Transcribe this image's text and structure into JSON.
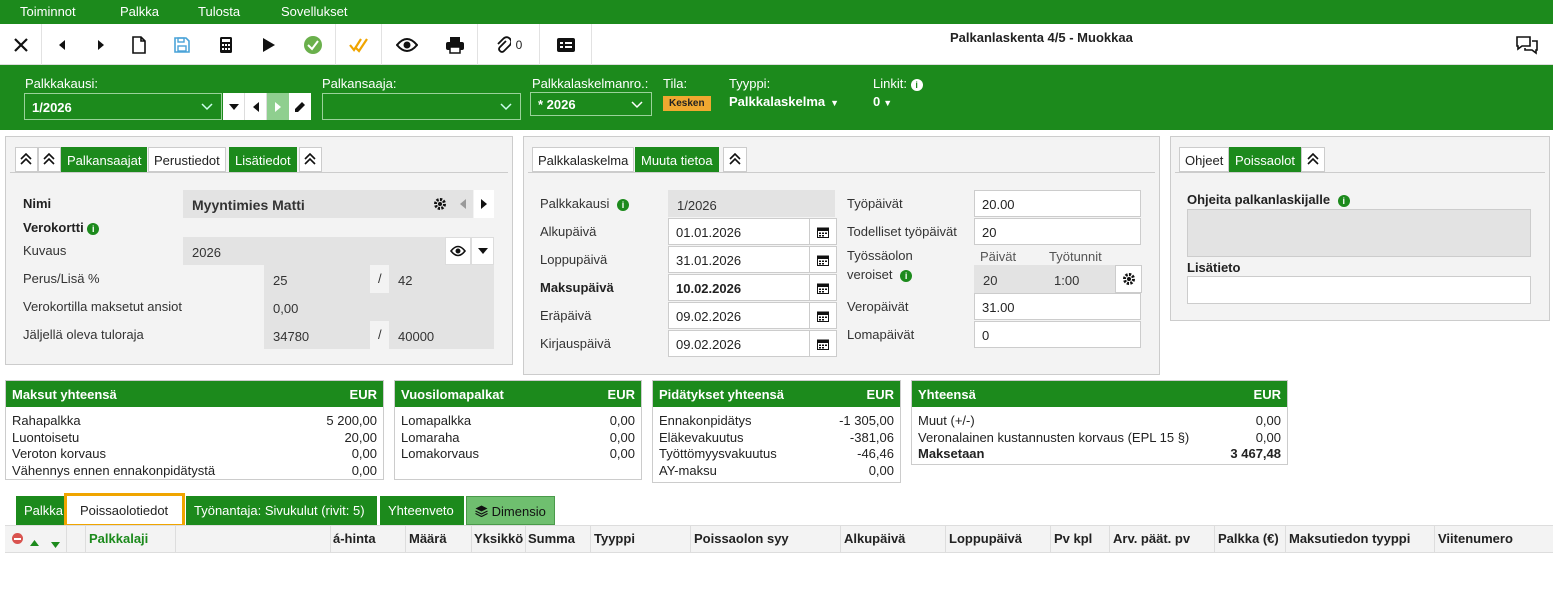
{
  "menu": [
    "Toiminnot",
    "Palkka",
    "Tulosta",
    "Sovellukset"
  ],
  "toolbar": {
    "attachments_count": "0"
  },
  "window_title": "Palkanlaskenta 4/5 - Muokkaa",
  "header": {
    "palkkakausi_label": "Palkkakausi:",
    "palkkakausi_value": "1/2026",
    "palkansaaja_label": "Palkansaaja:",
    "palkansaaja_value": "",
    "laskelmanro_label": "Palkkalaskelmanro.:",
    "laskelmanro_value": "* 2026",
    "tila_label": "Tila:",
    "tila_value": "Kesken",
    "tyyppi_label": "Tyyppi:",
    "tyyppi_value": "Palkkalaskelma",
    "linkit_label": "Linkit:",
    "linkit_value": "0"
  },
  "left_panel": {
    "tabs": [
      "Palkansaajat",
      "Perustiedot",
      "Lisätiedot"
    ],
    "nimi_label": "Nimi",
    "nimi_value": "Myyntimies Matti",
    "verokortti_label": "Verokortti",
    "kuvaus_label": "Kuvaus",
    "kuvaus_value": "2026",
    "perus_label": "Perus/Lisä %",
    "perus_value": "25",
    "lisa_value": "42",
    "maksetut_label": "Verokortilla maksetut ansiot",
    "maksetut_value": "0,00",
    "tuloraja_label": "Jäljellä oleva tuloraja",
    "tuloraja_value": "34780",
    "tuloraja_max": "40000",
    "slash": "/"
  },
  "mid_panel": {
    "tabs": [
      "Palkkalaskelma",
      "Muuta tietoa"
    ],
    "palkkakausi_label": "Palkkakausi",
    "palkkakausi_value": "1/2026",
    "alkupaiva_label": "Alkupäivä",
    "alkupaiva_value": "01.01.2026",
    "loppupaiva_label": "Loppupäivä",
    "loppupaiva_value": "31.01.2026",
    "maksupaiva_label": "Maksupäivä",
    "maksupaiva_value": "10.02.2026",
    "erapaiva_label": "Eräpäivä",
    "erapaiva_value": "09.02.2026",
    "kirjauspaiva_label": "Kirjauspäivä",
    "kirjauspaiva_value": "09.02.2026",
    "tyopaivat_label": "Työpäivät",
    "tyopaivat_value": "20.00",
    "todelliset_label": "Todelliset työpäivät",
    "todelliset_value": "20",
    "tyossaolon_label1": "Työssäolon",
    "tyossaolon_label2": "veroiset",
    "paivat_label": "Päivät",
    "tyotunnit_label": "Työtunnit",
    "paivat_value": "20",
    "tyotunnit_value": "1:00",
    "veropaivat_label": "Veropäivät",
    "veropaivat_value": "31.00",
    "lomapaivat_label": "Lomapäivät",
    "lomapaivat_value": "0"
  },
  "right_panel": {
    "tabs": [
      "Ohjeet",
      "Poissaolot"
    ],
    "ohjeita_label": "Ohjeita palkanlaskijalle",
    "lisatieto_label": "Lisätieto"
  },
  "summaries": [
    {
      "title": "Maksut yhteensä",
      "currency": "EUR",
      "rows": [
        [
          "Rahapalkka",
          "5 200,00"
        ],
        [
          "Luontoisetu",
          "20,00"
        ],
        [
          "Veroton korvaus",
          "0,00"
        ],
        [
          "Vähennys ennen ennakonpidätystä",
          "0,00"
        ]
      ]
    },
    {
      "title": "Vuosilomapalkat",
      "currency": "EUR",
      "rows": [
        [
          "Lomapalkka",
          "0,00"
        ],
        [
          "Lomaraha",
          "0,00"
        ],
        [
          "Lomakorvaus",
          "0,00"
        ]
      ]
    },
    {
      "title": "Pidätykset yhteensä",
      "currency": "EUR",
      "rows": [
        [
          "Ennakonpidätys",
          "-1 305,00"
        ],
        [
          "Eläkevakuutus",
          "-381,06"
        ],
        [
          "Työttömyysvakuutus",
          "-46,46"
        ],
        [
          "AY-maksu",
          "0,00"
        ]
      ]
    },
    {
      "title": "Yhteensä",
      "currency": "EUR",
      "rows": [
        [
          "Muut (+/-)",
          "0,00"
        ],
        [
          "Veronalainen kustannusten korvaus (EPL 15 §)",
          "0,00"
        ],
        [
          "Maksetaan",
          "3 467,48"
        ]
      ]
    }
  ],
  "bottom_tabs": [
    "Palkka",
    "Poissaolotiedot",
    "Työnantaja: Sivukulut (rivit: 5)",
    "Yhteenveto",
    "Dimensio"
  ],
  "table_columns": [
    "Palkkalaji",
    "á-hinta",
    "Määrä",
    "Yksikkö",
    "Summa",
    "Tyyppi",
    "Poissaolon syy",
    "Alkupäivä",
    "Loppupäivä",
    "Pv kpl",
    "Arv. päät. pv",
    "Palkka (€)",
    "Maksutiedon tyyppi",
    "Viitenumero"
  ],
  "colors": {
    "green": "#1c8a1c",
    "highlight": "#f0a500",
    "badge": "#f0a830"
  }
}
